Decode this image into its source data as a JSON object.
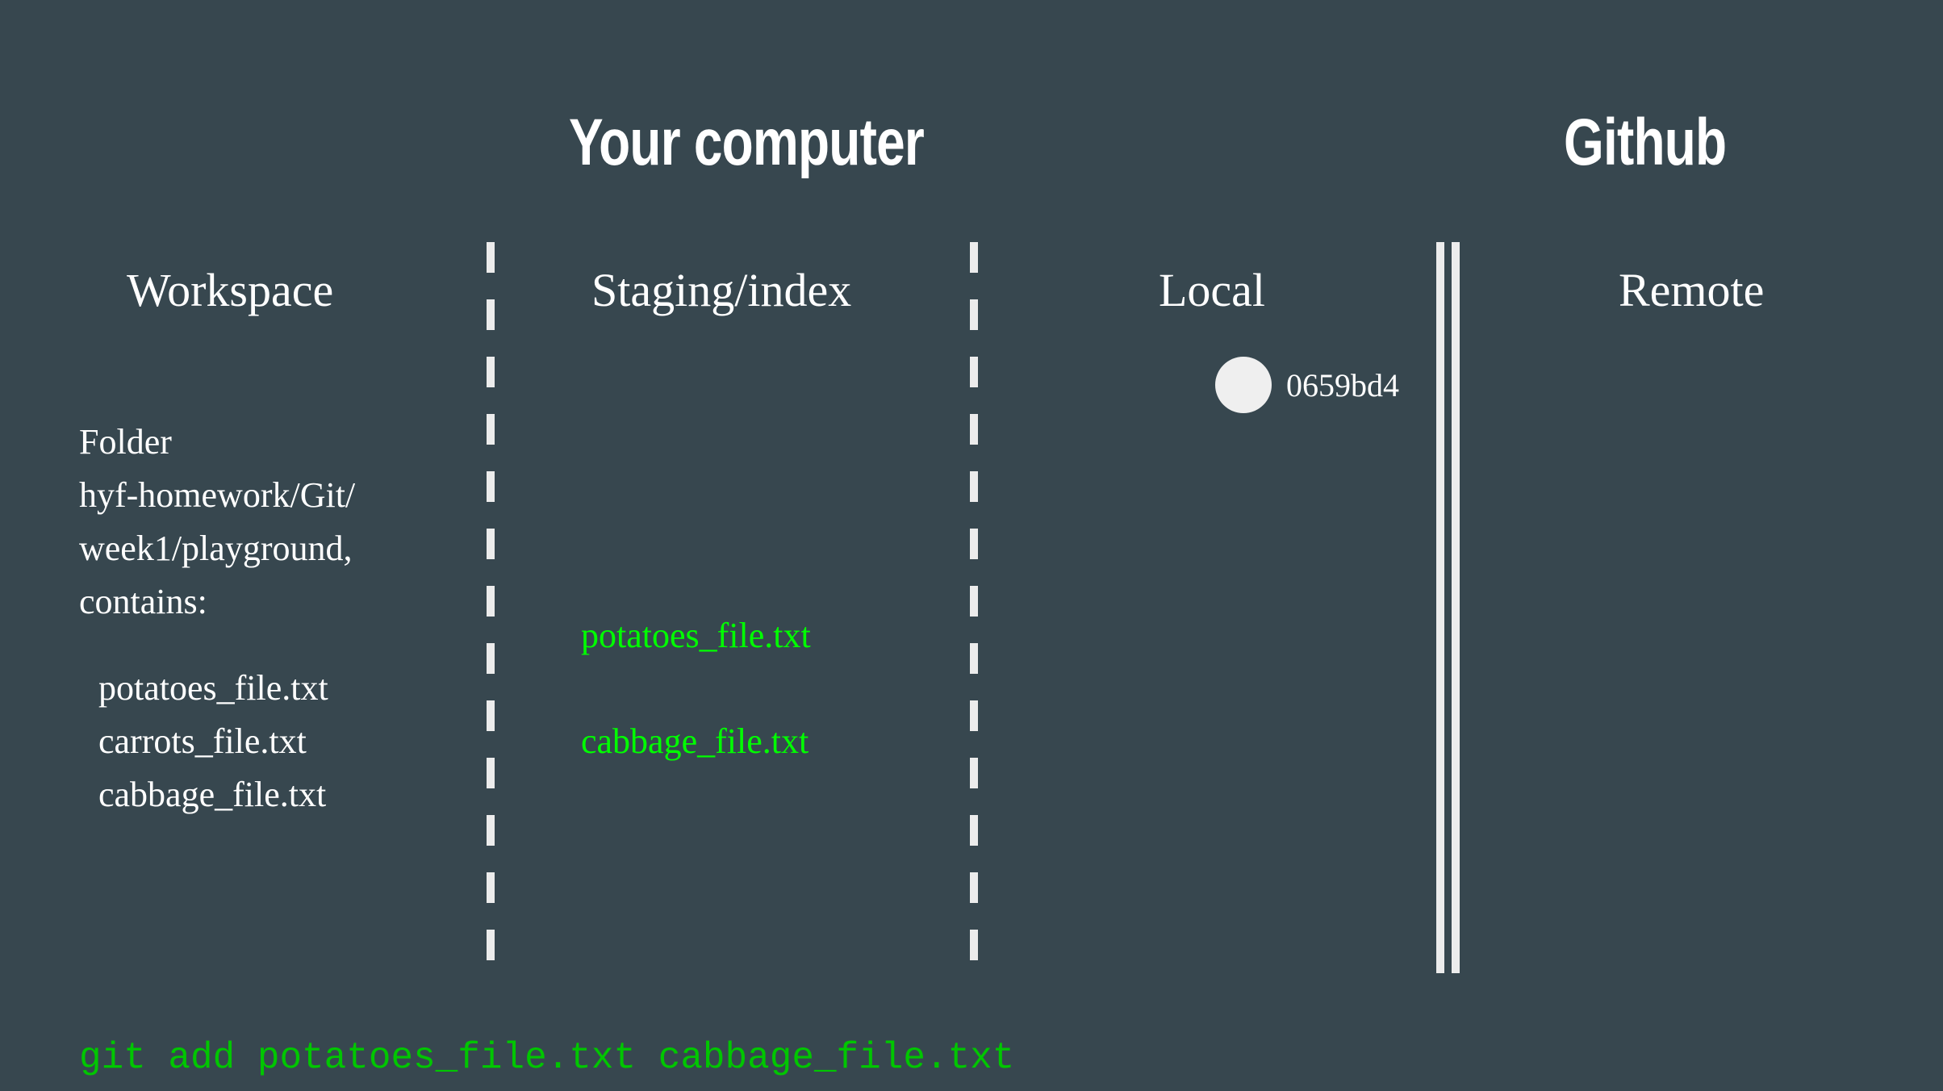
{
  "headings": {
    "your_computer": "Your computer",
    "github": "Github"
  },
  "columns": {
    "workspace": "Workspace",
    "staging": "Staging/index",
    "local": "Local",
    "remote": "Remote"
  },
  "workspace": {
    "folder_lines": [
      "Folder",
      "hyf-homework/Git/",
      "week1/playground,",
      "contains:"
    ],
    "files": [
      "potatoes_file.txt",
      "carrots_file.txt",
      "cabbage_file.txt"
    ]
  },
  "staging": {
    "files": [
      "potatoes_file.txt",
      "cabbage_file.txt"
    ]
  },
  "local": {
    "commit_hash": "0659bd4"
  },
  "command": "git add potatoes_file.txt cabbage_file.txt",
  "colors": {
    "background": "#37474f",
    "text": "#ffffff",
    "staged_text": "#00ff00",
    "command_text": "#00c600",
    "divider": "#ececec"
  }
}
